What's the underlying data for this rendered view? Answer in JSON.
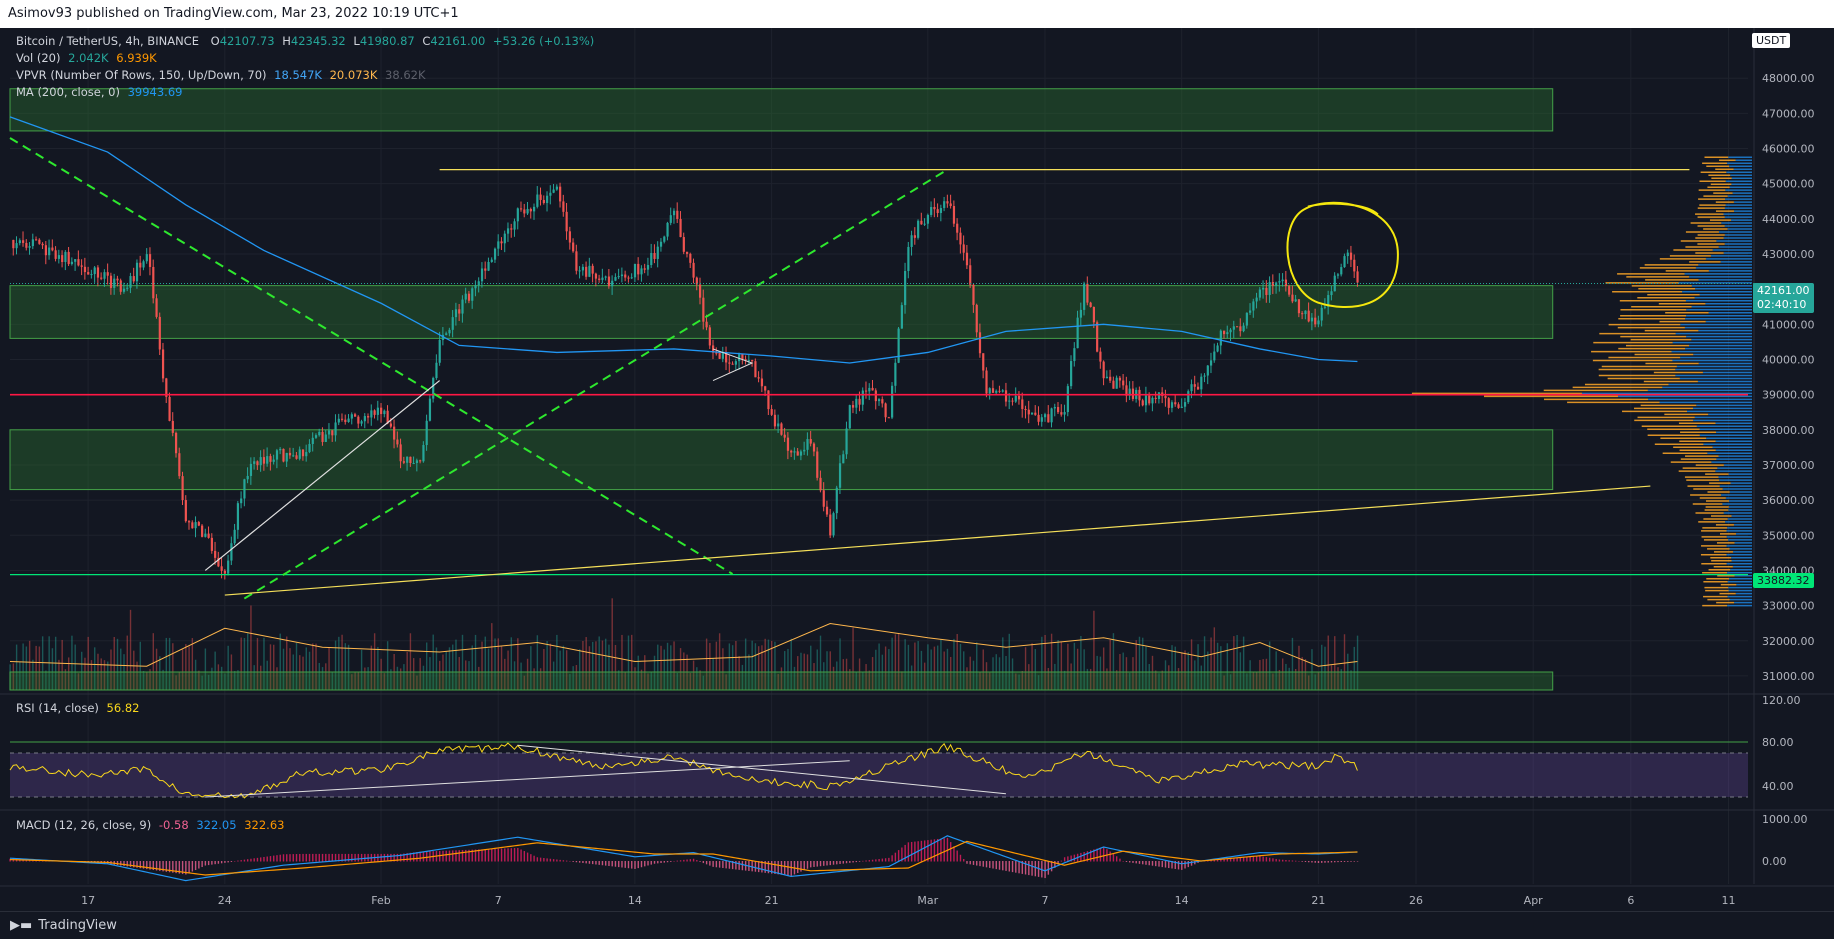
{
  "header": {
    "published": "Asimov93 published on TradingView.com, Mar 23, 2022 10:19 UTC+1"
  },
  "footer": {
    "brand": "TradingView"
  },
  "legend": {
    "symbol": "Bitcoin / TetherUS, 4h, BINANCE",
    "o_label": "O",
    "o": "42107.73",
    "h_label": "H",
    "h": "42345.32",
    "l_label": "L",
    "l": "41980.87",
    "c_label": "C",
    "c": "42161.00",
    "change": "+53.26 (+0.13%)",
    "vol_label": "Vol (20)",
    "vol_a": "2.042K",
    "vol_b": "6.939K",
    "vpvr_label": "VPVR (Number Of Rows, 150, Up/Down, 70)",
    "vpvr_a": "18.547K",
    "vpvr_b": "20.073K",
    "vpvr_c": "38.62K",
    "ma_label": "MA (200, close, 0)",
    "ma_val": "39943.69",
    "rsi_label": "RSI (14, close)",
    "rsi_val": "56.82",
    "macd_label": "MACD (12, 26, close, 9)",
    "macd_a": "-0.58",
    "macd_b": "322.05",
    "macd_c": "322.63"
  },
  "price_axis": {
    "currency": "USDT",
    "ticks": [
      "48000.00",
      "47000.00",
      "46000.00",
      "45000.00",
      "44000.00",
      "43000.00",
      "41000.00",
      "40000.00",
      "39000.00",
      "38000.00",
      "37000.00",
      "36000.00",
      "35000.00",
      "34000.00",
      "33000.00",
      "32000.00",
      "31000.00"
    ],
    "last_price": "42161.00",
    "countdown": "02:40:10",
    "level_label": "33882.32",
    "rsi_ticks": [
      "120.00",
      "80.00",
      "40.00"
    ],
    "macd_ticks": [
      "1000.00",
      "0.00"
    ]
  },
  "time_axis": {
    "ticks": [
      "17",
      "24",
      "Feb",
      "7",
      "14",
      "21",
      "Mar",
      "7",
      "14",
      "21",
      "26",
      "Apr",
      "6",
      "11"
    ]
  },
  "colors": {
    "background": "#131722",
    "up": "#26a69a",
    "down": "#ef5350",
    "ma": "#2962ff",
    "zone": "#1b5e20",
    "rsi": "#f9d71c",
    "yellow_line": "#f5e05a",
    "support": "#00e676",
    "resistance_red": "#ff1744"
  },
  "chart_data": {
    "type": "candlestick",
    "timeframe": "4h",
    "ylim": [
      30600,
      49200
    ],
    "x_start": "2022-01-13",
    "x_end": "2022-04-12",
    "close_path": [
      [
        "2022-01-13",
        43400
      ],
      [
        "2022-01-15",
        43100
      ],
      [
        "2022-01-17",
        42500
      ],
      [
        "2022-01-19",
        42000
      ],
      [
        "2022-01-20",
        43200
      ],
      [
        "2022-01-21",
        38900
      ],
      [
        "2022-01-22",
        35400
      ],
      [
        "2022-01-23",
        35100
      ],
      [
        "2022-01-24",
        33800
      ],
      [
        "2022-01-25",
        36700
      ],
      [
        "2022-01-26",
        37200
      ],
      [
        "2022-01-28",
        37400
      ],
      [
        "2022-01-30",
        38200
      ],
      [
        "2022-02-01",
        38600
      ],
      [
        "2022-02-02",
        37300
      ],
      [
        "2022-02-03",
        36900
      ],
      [
        "2022-02-04",
        40500
      ],
      [
        "2022-02-05",
        41400
      ],
      [
        "2022-02-07",
        43300
      ],
      [
        "2022-02-08",
        44200
      ],
      [
        "2022-02-10",
        44800
      ],
      [
        "2022-02-11",
        42600
      ],
      [
        "2022-02-13",
        42200
      ],
      [
        "2022-02-15",
        42900
      ],
      [
        "2022-02-16",
        44100
      ],
      [
        "2022-02-17",
        42300
      ],
      [
        "2022-02-18",
        40100
      ],
      [
        "2022-02-20",
        39900
      ],
      [
        "2022-02-21",
        38500
      ],
      [
        "2022-02-22",
        37300
      ],
      [
        "2022-02-23",
        37600
      ],
      [
        "2022-02-24",
        35200
      ],
      [
        "2022-02-25",
        38600
      ],
      [
        "2022-02-26",
        39200
      ],
      [
        "2022-02-27",
        38400
      ],
      [
        "2022-02-28",
        43300
      ],
      [
        "2022-03-01",
        44200
      ],
      [
        "2022-03-02",
        44500
      ],
      [
        "2022-03-03",
        42700
      ],
      [
        "2022-03-04",
        39200
      ],
      [
        "2022-03-06",
        38700
      ],
      [
        "2022-03-07",
        38300
      ],
      [
        "2022-03-08",
        38600
      ],
      [
        "2022-03-09",
        42200
      ],
      [
        "2022-03-10",
        39500
      ],
      [
        "2022-03-12",
        38900
      ],
      [
        "2022-03-14",
        38800
      ],
      [
        "2022-03-15",
        39400
      ],
      [
        "2022-03-16",
        40800
      ],
      [
        "2022-03-17",
        40900
      ],
      [
        "2022-03-18",
        41800
      ],
      [
        "2022-03-19",
        42200
      ],
      [
        "2022-03-20",
        41400
      ],
      [
        "2022-03-21",
        41100
      ],
      [
        "2022-03-22",
        42400
      ],
      [
        "2022-03-22T12:00",
        43000
      ],
      [
        "2022-03-23",
        42161
      ]
    ],
    "ma200_path": [
      [
        "2022-01-13",
        46900
      ],
      [
        "2022-01-18",
        45900
      ],
      [
        "2022-01-22",
        44400
      ],
      [
        "2022-01-26",
        43100
      ],
      [
        "2022-02-01",
        41600
      ],
      [
        "2022-02-05",
        40400
      ],
      [
        "2022-02-10",
        40200
      ],
      [
        "2022-02-16",
        40300
      ],
      [
        "2022-02-21",
        40100
      ],
      [
        "2022-02-25",
        39900
      ],
      [
        "2022-03-01",
        40200
      ],
      [
        "2022-03-05",
        40800
      ],
      [
        "2022-03-10",
        41000
      ],
      [
        "2022-03-14",
        40800
      ],
      [
        "2022-03-18",
        40300
      ],
      [
        "2022-03-21",
        40000
      ],
      [
        "2022-03-23",
        39943.69
      ]
    ],
    "zones": [
      {
        "from": 46500,
        "to": 47700,
        "end": "2022-04-02"
      },
      {
        "from": 40600,
        "to": 42100,
        "end": "2022-04-02"
      },
      {
        "from": 36300,
        "to": 38000,
        "end": "2022-04-02"
      }
    ],
    "levels": [
      {
        "price": 45400,
        "color": "yellow",
        "from": "2022-02-04",
        "to": "2022-04-09"
      },
      {
        "price": 39000,
        "color": "red",
        "from": "2022-01-13",
        "to": "2022-04-12"
      },
      {
        "price": 33882.32,
        "color": "green",
        "from": "2022-01-13",
        "to": "2022-04-12"
      }
    ],
    "trendlines": [
      {
        "style": "dashed",
        "color": "green",
        "from": [
          "2022-01-13",
          46300
        ],
        "to": [
          "2022-02-19",
          33900
        ]
      },
      {
        "style": "dashed",
        "color": "green",
        "from": [
          "2022-01-25",
          33200
        ],
        "to": [
          "2022-03-02",
          45400
        ]
      },
      {
        "style": "solid",
        "color": "white",
        "from": [
          "2022-01-23",
          34000
        ],
        "to": [
          "2022-02-04",
          39400
        ]
      },
      {
        "style": "solid",
        "color": "yellow",
        "from": [
          "2022-01-24",
          33300
        ],
        "to": [
          "2022-04-07",
          36400
        ]
      }
    ],
    "volume": {
      "ma_path": [
        [
          "2022-01-13",
          0.3
        ],
        [
          "2022-01-20",
          0.25
        ],
        [
          "2022-01-24",
          0.65
        ],
        [
          "2022-01-29",
          0.45
        ],
        [
          "2022-02-04",
          0.4
        ],
        [
          "2022-02-09",
          0.5
        ],
        [
          "2022-02-14",
          0.3
        ],
        [
          "2022-02-20",
          0.35
        ],
        [
          "2022-02-24",
          0.7
        ],
        [
          "2022-03-01",
          0.55
        ],
        [
          "2022-03-05",
          0.45
        ],
        [
          "2022-03-10",
          0.55
        ],
        [
          "2022-03-15",
          0.35
        ],
        [
          "2022-03-18",
          0.5
        ],
        [
          "2022-03-21",
          0.25
        ],
        [
          "2022-03-23",
          0.3
        ]
      ]
    },
    "vpvr_peak_price": 39000,
    "rsi": {
      "ylim": [
        20,
        120
      ],
      "bands": [
        30,
        70
      ],
      "path": [
        [
          "2022-01-13",
          58
        ],
        [
          "2022-01-17",
          50
        ],
        [
          "2022-01-20",
          55
        ],
        [
          "2022-01-22",
          32
        ],
        [
          "2022-01-25",
          30
        ],
        [
          "2022-01-28",
          52
        ],
        [
          "2022-02-01",
          55
        ],
        [
          "2022-02-04",
          72
        ],
        [
          "2022-02-08",
          76
        ],
        [
          "2022-02-12",
          58
        ],
        [
          "2022-02-16",
          66
        ],
        [
          "2022-02-20",
          45
        ],
        [
          "2022-02-24",
          40
        ],
        [
          "2022-02-28",
          64
        ],
        [
          "2022-03-02",
          76
        ],
        [
          "2022-03-06",
          46
        ],
        [
          "2022-03-09",
          70
        ],
        [
          "2022-03-13",
          45
        ],
        [
          "2022-03-17",
          60
        ],
        [
          "2022-03-21",
          58
        ],
        [
          "2022-03-22",
          68
        ],
        [
          "2022-03-23",
          56.82
        ]
      ]
    },
    "macd": {
      "macd_path": [
        [
          "2022-01-13",
          100
        ],
        [
          "2022-01-18",
          -100
        ],
        [
          "2022-01-22",
          -700
        ],
        [
          "2022-01-27",
          -150
        ],
        [
          "2022-02-02",
          200
        ],
        [
          "2022-02-08",
          850
        ],
        [
          "2022-02-14",
          150
        ],
        [
          "2022-02-17",
          300
        ],
        [
          "2022-02-22",
          -550
        ],
        [
          "2022-02-27",
          -200
        ],
        [
          "2022-03-02",
          900
        ],
        [
          "2022-03-07",
          -350
        ],
        [
          "2022-03-10",
          500
        ],
        [
          "2022-03-14",
          -100
        ],
        [
          "2022-03-18",
          300
        ],
        [
          "2022-03-21",
          250
        ],
        [
          "2022-03-23",
          322.05
        ]
      ],
      "signal_path": [
        [
          "2022-01-13",
          50
        ],
        [
          "2022-01-18",
          -50
        ],
        [
          "2022-01-23",
          -500
        ],
        [
          "2022-01-28",
          -250
        ],
        [
          "2022-02-03",
          100
        ],
        [
          "2022-02-09",
          650
        ],
        [
          "2022-02-15",
          250
        ],
        [
          "2022-02-18",
          250
        ],
        [
          "2022-02-23",
          -350
        ],
        [
          "2022-02-28",
          -250
        ],
        [
          "2022-03-03",
          700
        ],
        [
          "2022-03-08",
          -150
        ],
        [
          "2022-03-11",
          350
        ],
        [
          "2022-03-15",
          0
        ],
        [
          "2022-03-19",
          250
        ],
        [
          "2022-03-22",
          300
        ],
        [
          "2022-03-23",
          322.63
        ]
      ]
    }
  }
}
